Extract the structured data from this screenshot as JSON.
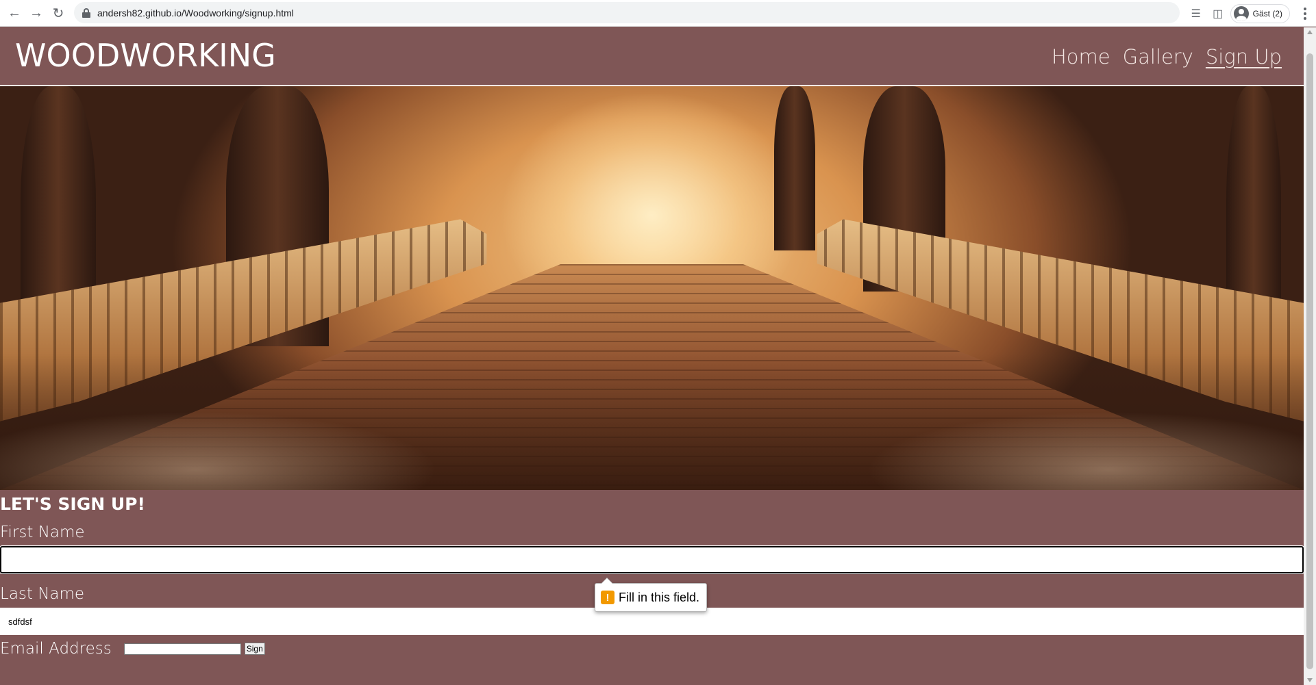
{
  "browser": {
    "url": "andersh82.github.io/Woodworking/signup.html",
    "profile_label": "Gäst (2)",
    "icons": [
      "back-arrow-icon",
      "forward-arrow-icon",
      "reload-icon",
      "lock-icon",
      "reading-list-icon",
      "side-panel-icon",
      "profile-icon",
      "menu-kebab-icon"
    ]
  },
  "header": {
    "logo": "WOODWORKING",
    "nav": [
      {
        "label": "Home"
      },
      {
        "label": "Gallery"
      },
      {
        "label": "Sign Up",
        "active": true
      }
    ]
  },
  "form": {
    "heading": "LET'S SIGN UP!",
    "first_name_label": "First Name",
    "first_name_value": "",
    "last_name_label": "Last Name",
    "last_name_value": "sdfdsf",
    "email_label": "Email Address",
    "email_value": "",
    "submit_label": "Sign"
  },
  "validation": {
    "message": "Fill in this field.",
    "icon": "!"
  },
  "colors": {
    "page_background": "#7f5656",
    "warning": "#f29900"
  }
}
